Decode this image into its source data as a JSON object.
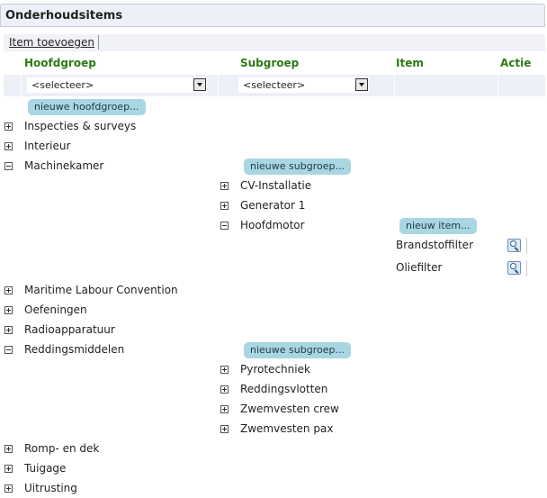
{
  "panel": {
    "title": "Onderhoudsitems"
  },
  "toolbar": {
    "add_item_label": "Item toevoegen"
  },
  "columns": {
    "hoofdgroep": "Hoofdgroep",
    "subgroep": "Subgroep",
    "item": "Item",
    "actie": "Actie"
  },
  "filters": {
    "hoofdgroep_value": "<selecteer>",
    "subgroep_value": "<selecteer>"
  },
  "buttons": {
    "new_hoofdgroep": "nieuwe hoofdgroep...",
    "new_subgroep": "nieuwe subgroep...",
    "new_item": "nieuw item..."
  },
  "tree": {
    "groups": [
      {
        "label": "Inspecties & surveys",
        "expanded": false
      },
      {
        "label": "Interieur",
        "expanded": false
      },
      {
        "label": "Machinekamer",
        "expanded": true,
        "subgroups": [
          {
            "label": "CV-Installatie",
            "expanded": false
          },
          {
            "label": "Generator 1",
            "expanded": false
          },
          {
            "label": "Hoofdmotor",
            "expanded": true,
            "items": [
              "Brandstoffilter",
              "Oliefilter"
            ]
          }
        ]
      },
      {
        "label": "Maritime Labour Convention",
        "expanded": false
      },
      {
        "label": "Oefeningen",
        "expanded": false
      },
      {
        "label": "Radioapparatuur",
        "expanded": false
      },
      {
        "label": "Reddingsmiddelen",
        "expanded": true,
        "subgroups": [
          {
            "label": "Pyrotechniek",
            "expanded": false
          },
          {
            "label": "Reddingsvlotten",
            "expanded": false
          },
          {
            "label": "Zwemvesten crew",
            "expanded": false
          },
          {
            "label": "Zwemvesten pax",
            "expanded": false
          }
        ]
      },
      {
        "label": "Romp- en dek",
        "expanded": false
      },
      {
        "label": "Tuigage",
        "expanded": false
      },
      {
        "label": "Uitrusting",
        "expanded": false
      }
    ]
  },
  "icons": {
    "expand": "plus-box-icon",
    "collapse": "minus-box-icon",
    "action": "magnifier-icon",
    "dropdown": "dropdown-arrow-icon"
  }
}
